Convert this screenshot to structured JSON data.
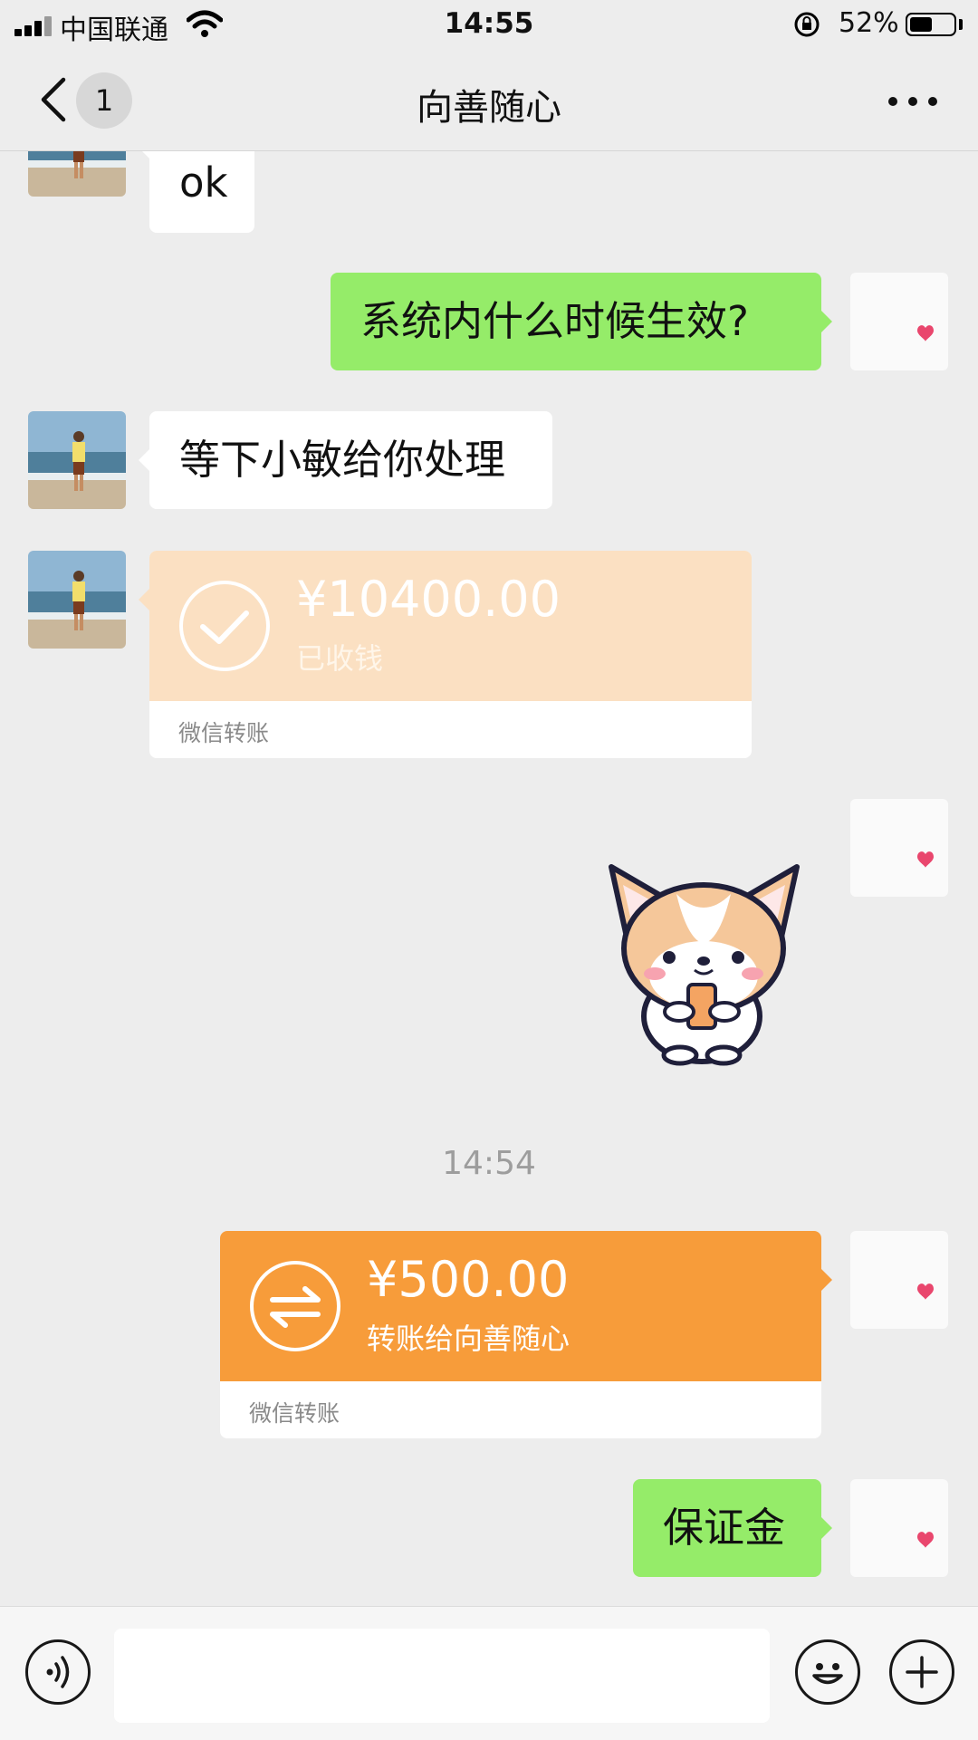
{
  "status_bar": {
    "carrier": "中国联通",
    "time": "14:55",
    "battery_percent": "52%",
    "battery_level": 0.52
  },
  "nav": {
    "unread_badge": "1",
    "title": "向善随心",
    "icons": {
      "back": "chevron-left-icon",
      "more": "more-dots-icon"
    }
  },
  "messages": [
    {
      "side": "left",
      "type": "text",
      "text": "ok"
    },
    {
      "side": "right",
      "type": "text",
      "text": "系统内什么时候生效?"
    },
    {
      "side": "left",
      "type": "text",
      "text": "等下小敏给你处理"
    },
    {
      "side": "left",
      "type": "transfer",
      "amount": "¥10400.00",
      "status": "已收钱",
      "footer": "微信转账",
      "icon": "check-circle-icon"
    },
    {
      "side": "right",
      "type": "sticker",
      "sticker": "corgi-with-phone"
    },
    {
      "type": "timestamp",
      "text": "14:54"
    },
    {
      "side": "right",
      "type": "transfer",
      "amount": "¥500.00",
      "status": "转账给向善随心",
      "footer": "微信转账",
      "icon": "exchange-icon"
    },
    {
      "side": "right",
      "type": "text",
      "text": "保证金"
    }
  ],
  "input_bar": {
    "icons": {
      "voice": "voice-icon",
      "emoji": "emoji-icon",
      "add": "plus-icon"
    }
  },
  "colors": {
    "chat_background": "#ededed",
    "self_bubble": "#95ec69",
    "received_transfer": "#fbe0c2",
    "sent_transfer": "#f79c3a",
    "heart": "#e9466d"
  }
}
